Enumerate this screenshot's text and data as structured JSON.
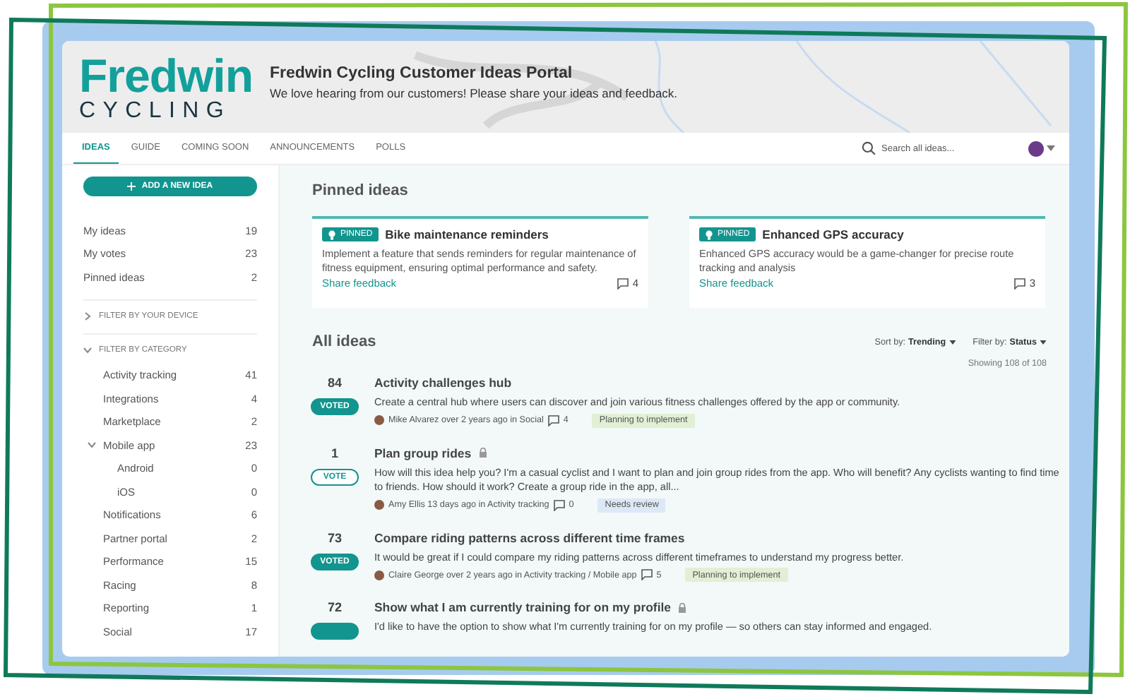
{
  "header": {
    "logo_word": "Fredwin",
    "logo_sub": "CYCLING",
    "title": "Fredwin Cycling Customer Ideas Portal",
    "subtitle": "We love hearing from our customers! Please share your ideas and feedback."
  },
  "tabs": [
    {
      "label": "IDEAS",
      "selected": true
    },
    {
      "label": "GUIDE",
      "selected": false
    },
    {
      "label": "COMING SOON",
      "selected": false
    },
    {
      "label": "ANNOUNCEMENTS",
      "selected": false
    },
    {
      "label": "POLLS",
      "selected": false
    }
  ],
  "search": {
    "placeholder": "Search all ideas..."
  },
  "sidebar": {
    "add_button": "ADD A NEW IDEA",
    "links": [
      {
        "label": "My ideas",
        "count": "19"
      },
      {
        "label": "My votes",
        "count": "23"
      },
      {
        "label": "Pinned ideas",
        "count": "2"
      }
    ],
    "filters": [
      {
        "label": "FILTER BY YOUR DEVICE",
        "expanded": false
      },
      {
        "label": "FILTER BY CATEGORY",
        "expanded": true,
        "items": [
          {
            "label": "Activity tracking",
            "count": "41"
          },
          {
            "label": "Integrations",
            "count": "4"
          },
          {
            "label": "Marketplace",
            "count": "2"
          },
          {
            "label": "Mobile app",
            "count": "23",
            "expanded": true,
            "children": [
              {
                "label": "Android",
                "count": "0"
              },
              {
                "label": "iOS",
                "count": "0"
              }
            ]
          },
          {
            "label": "Notifications",
            "count": "6"
          },
          {
            "label": "Partner portal",
            "count": "2"
          },
          {
            "label": "Performance",
            "count": "15"
          },
          {
            "label": "Racing",
            "count": "8"
          },
          {
            "label": "Reporting",
            "count": "1"
          },
          {
            "label": "Social",
            "count": "17"
          }
        ]
      }
    ]
  },
  "pinned": {
    "heading": "Pinned ideas",
    "cards": [
      {
        "badge": "PINNED",
        "title": "Bike maintenance reminders",
        "description": "Implement a feature that sends reminders for regular maintenance of fitness equipment, ensuring optimal performance and safety.",
        "link": "Share feedback",
        "comments": "4"
      },
      {
        "badge": "PINNED",
        "title": "Enhanced GPS accuracy",
        "description": "Enhanced GPS accuracy would be a game-changer for precise route tracking and analysis",
        "link": "Share feedback",
        "comments": "3"
      }
    ]
  },
  "ideas": {
    "heading": "All ideas",
    "sort_label": "Sort by:",
    "sort_value": "Trending",
    "filter_label": "Filter by:",
    "filter_value": "Status",
    "showing": "Showing 108 of 108",
    "items": [
      {
        "votes": "84",
        "vote_label": "VOTED",
        "voted": true,
        "title": "Activity challenges hub",
        "locked": false,
        "description": "Create a central hub where users can discover and join various fitness challenges offered by the app or community.",
        "author": "Mike Alvarez over 2 years ago in Social",
        "comments": "4",
        "status": "Planning to implement",
        "color": "#e2efd5"
      },
      {
        "votes": "1",
        "vote_label": "VOTE",
        "voted": false,
        "title": "Plan group rides",
        "locked": true,
        "description": "How will this idea help you? I'm a casual cyclist and I want to plan and join group rides from the app. Who will benefit? Any cyclists wanting to find time to friends. How should it work? Create a group ride in the app, all...",
        "author": "Amy Ellis 13 days ago in Activity tracking",
        "comments": "0",
        "status": "Needs review",
        "color": "#dde8f7"
      },
      {
        "votes": "73",
        "vote_label": "VOTED",
        "voted": true,
        "title": "Compare riding patterns across different time frames",
        "locked": false,
        "description": "It would be great if I could compare my riding patterns across different timeframes to understand my progress better.",
        "author": "Claire George over 2 years ago in Activity tracking / Mobile app",
        "comments": "5",
        "status": "Planning to implement",
        "color": "#e2efd5"
      },
      {
        "votes": "72",
        "voted": true,
        "title": "Show what I am currently training for on my profile",
        "locked": true,
        "description": "I'd like to have the option to show what I'm currently training for on my profile — so others can stay informed and engaged."
      }
    ]
  }
}
